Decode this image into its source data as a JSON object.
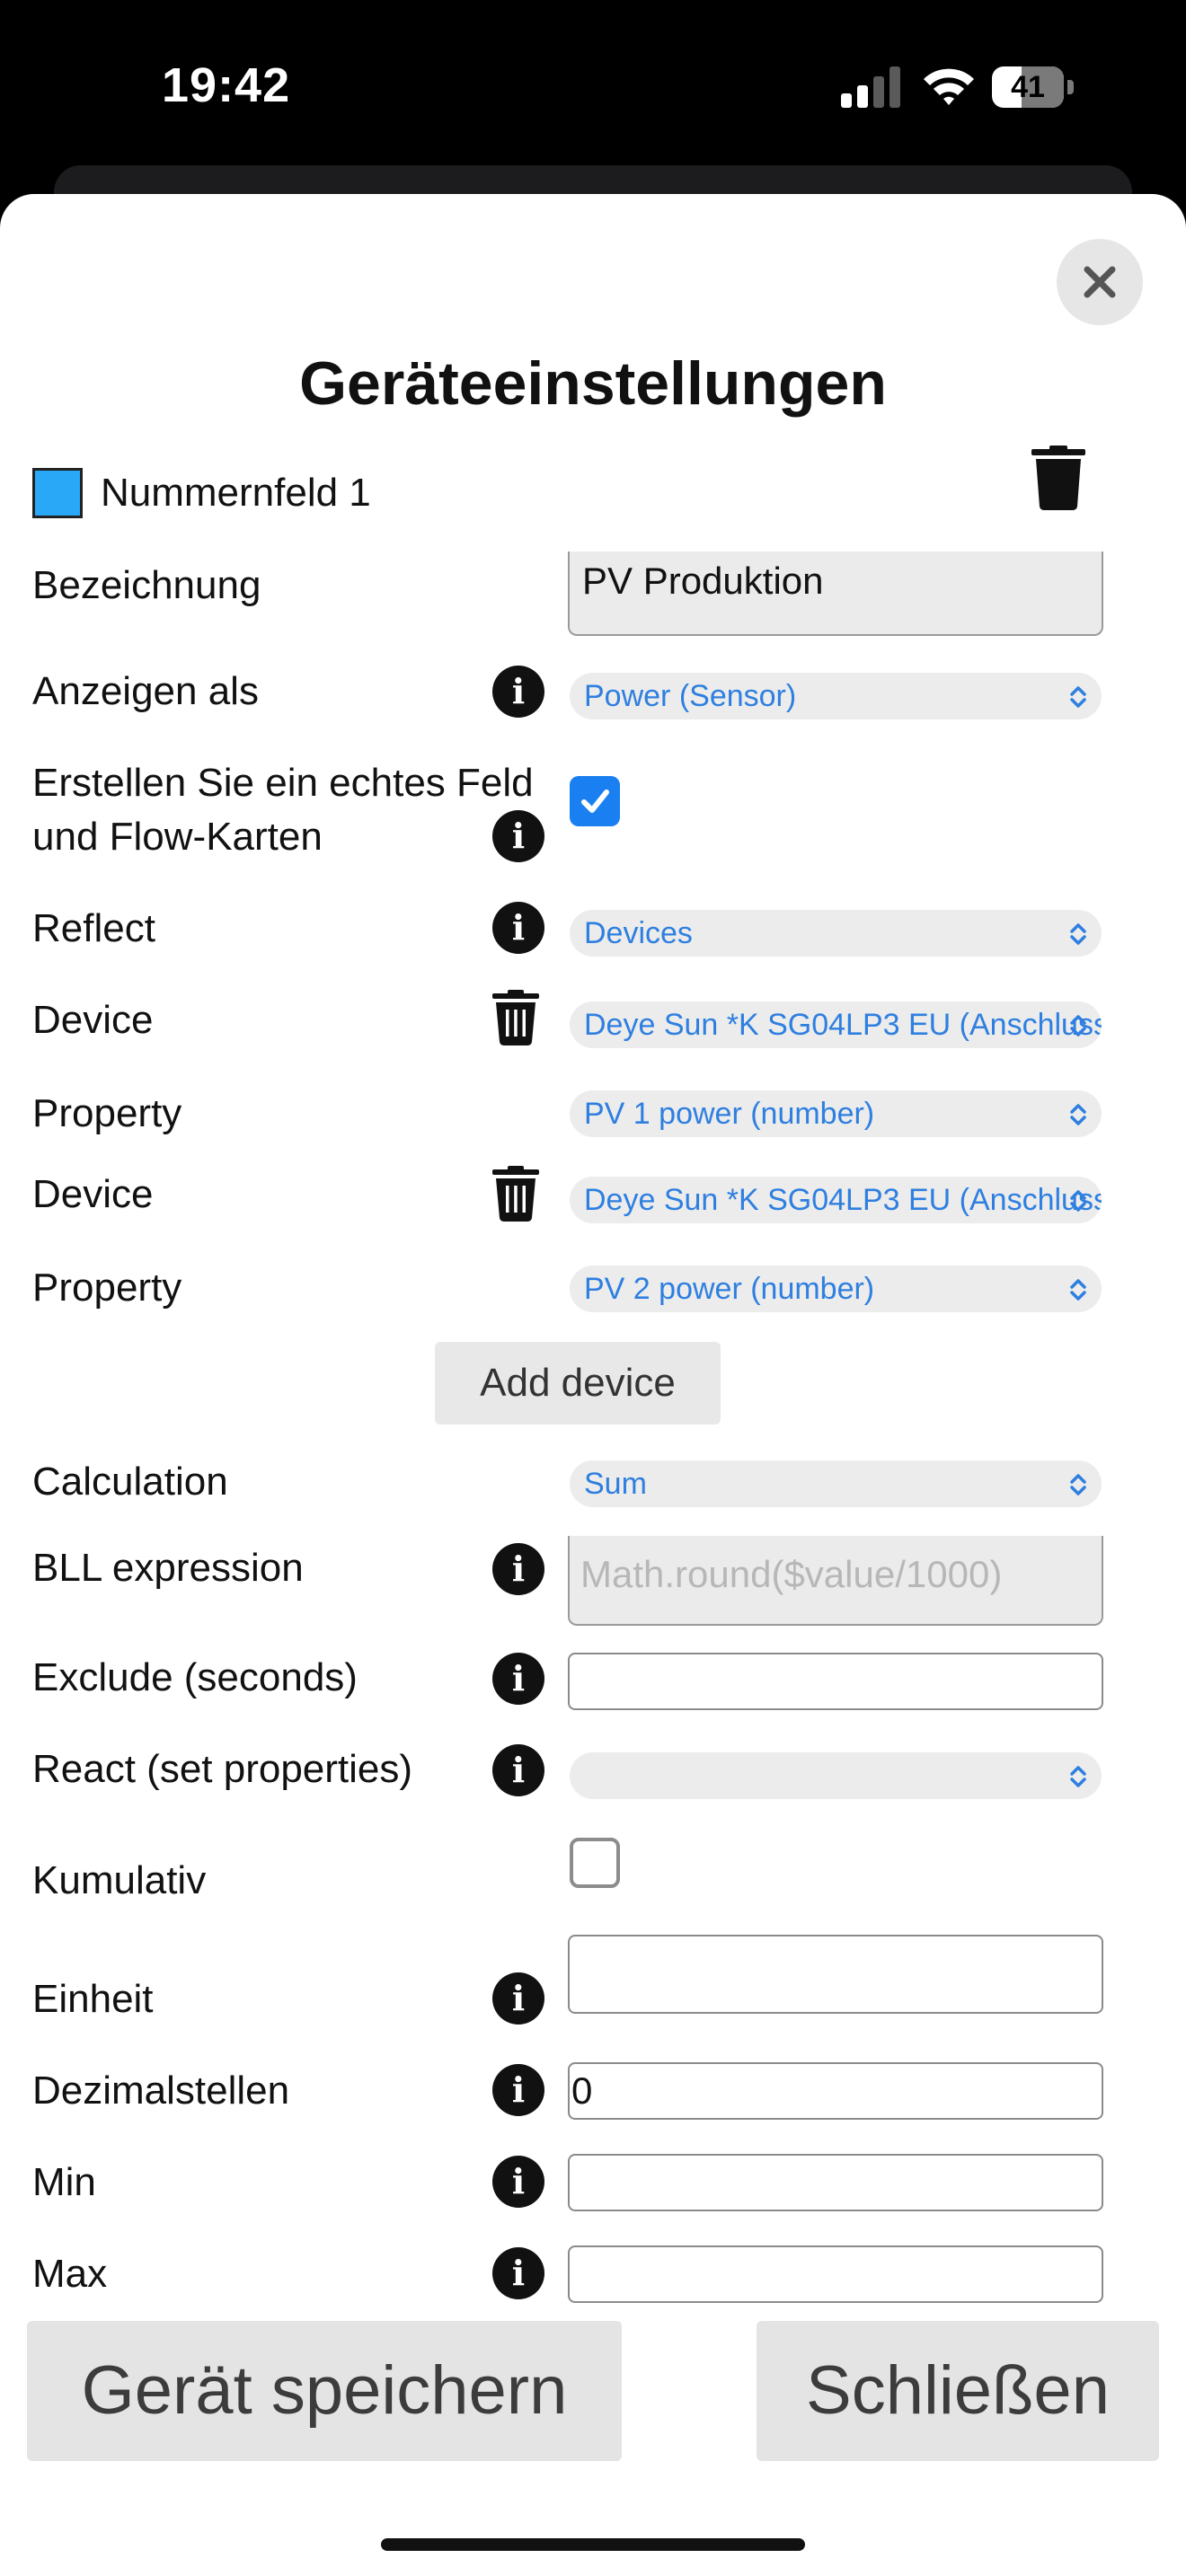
{
  "status_bar": {
    "time": "19:42",
    "battery_percent": "41",
    "battery_level": 0.41
  },
  "modal": {
    "title": "Geräteeinstellungen",
    "widget": {
      "name": "Nummernfeld 1",
      "color": "#2aa8f8"
    },
    "fields": {
      "bezeichnung": {
        "label": "Bezeichnung",
        "value": "PV Produktion"
      },
      "anzeigen_als": {
        "label": "Anzeigen als",
        "value": "Power (Sensor)"
      },
      "erstellen": {
        "label_line1": "Erstellen Sie ein echtes Feld",
        "label_line2": "und Flow-Karten",
        "checked": true
      },
      "reflect": {
        "label": "Reflect",
        "value": "Devices"
      },
      "devices": [
        {
          "device_label": "Device",
          "device_value": "Deye Sun *K SG04LP3 EU (Anschluss)",
          "property_label": "Property",
          "property_value": "PV 1 power (number)"
        },
        {
          "device_label": "Device",
          "device_value": "Deye Sun *K SG04LP3 EU (Anschluss)",
          "property_label": "Property",
          "property_value": "PV 2 power (number)"
        }
      ],
      "add_device_label": "Add device",
      "calculation": {
        "label": "Calculation",
        "value": "Sum"
      },
      "bll_expression": {
        "label": "BLL expression",
        "placeholder": "Math.round($value/1000)"
      },
      "exclude": {
        "label": "Exclude (seconds)",
        "value": ""
      },
      "react": {
        "label": "React (set properties)",
        "value": ""
      },
      "kumulativ": {
        "label": "Kumulativ",
        "checked": false
      },
      "einheit": {
        "label": "Einheit",
        "value": ""
      },
      "dezimalstellen": {
        "label": "Dezimalstellen",
        "value": "0"
      },
      "min": {
        "label": "Min",
        "value": ""
      },
      "max": {
        "label": "Max",
        "value": ""
      }
    },
    "buttons": {
      "save": "Gerät speichern",
      "close": "Schließen"
    }
  },
  "icons": {
    "info": "i",
    "close": "close-icon",
    "trash": "trash-icon",
    "chevron": "chevron-up-down-icon"
  },
  "colors": {
    "accent": "#1a7ff0",
    "select_text": "#2e7fe0",
    "swatch": "#2aa8f8"
  }
}
